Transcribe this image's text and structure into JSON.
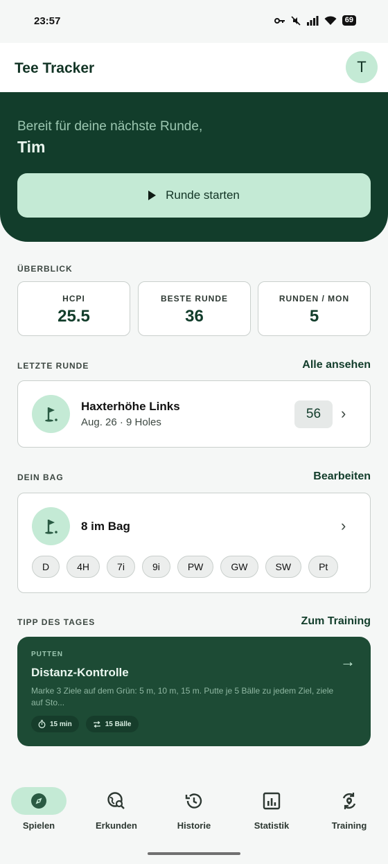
{
  "status_bar": {
    "time": "23:57",
    "battery": "69"
  },
  "app_bar": {
    "title": "Tee Tracker",
    "avatar_initial": "T"
  },
  "hero": {
    "greeting": "Bereit für deine nächste Runde,",
    "name": "Tim",
    "start_button": "Runde starten"
  },
  "overview": {
    "label": "ÜBERBLICK",
    "stats": [
      {
        "label": "HCPI",
        "value": "25.5"
      },
      {
        "label": "BESTE RUNDE",
        "value": "36"
      },
      {
        "label": "RUNDEN / MON",
        "value": "5"
      }
    ]
  },
  "last_round": {
    "label": "LETZTE RUNDE",
    "link": "Alle ansehen",
    "course": "Haxterhöhe Links",
    "details": "Aug. 26 · 9 Holes",
    "score": "56"
  },
  "bag": {
    "label": "DEIN BAG",
    "link": "Bearbeiten",
    "count": "8 im Bag",
    "clubs": [
      "D",
      "4H",
      "7i",
      "9i",
      "PW",
      "GW",
      "SW",
      "Pt"
    ]
  },
  "tip": {
    "label": "TIPP DES TAGES",
    "link": "Zum Training",
    "category": "PUTTEN",
    "title": "Distanz-Kontrolle",
    "description": "Marke 3 Ziele auf dem Grün: 5 m, 10 m, 15 m. Putte je 5 Bälle zu jedem Ziel, ziele auf Sto...",
    "duration": "15 min",
    "balls": "15 Bälle"
  },
  "nav": {
    "items": [
      {
        "label": "Spielen",
        "icon": "compass-icon",
        "active": true
      },
      {
        "label": "Erkunden",
        "icon": "globe-search-icon",
        "active": false
      },
      {
        "label": "Historie",
        "icon": "history-icon",
        "active": false
      },
      {
        "label": "Statistik",
        "icon": "chart-icon",
        "active": false
      },
      {
        "label": "Training",
        "icon": "training-icon",
        "active": false
      }
    ]
  },
  "colors": {
    "primary": "#123d2b",
    "accent": "#c4ead5",
    "background": "#f5f7f6"
  }
}
